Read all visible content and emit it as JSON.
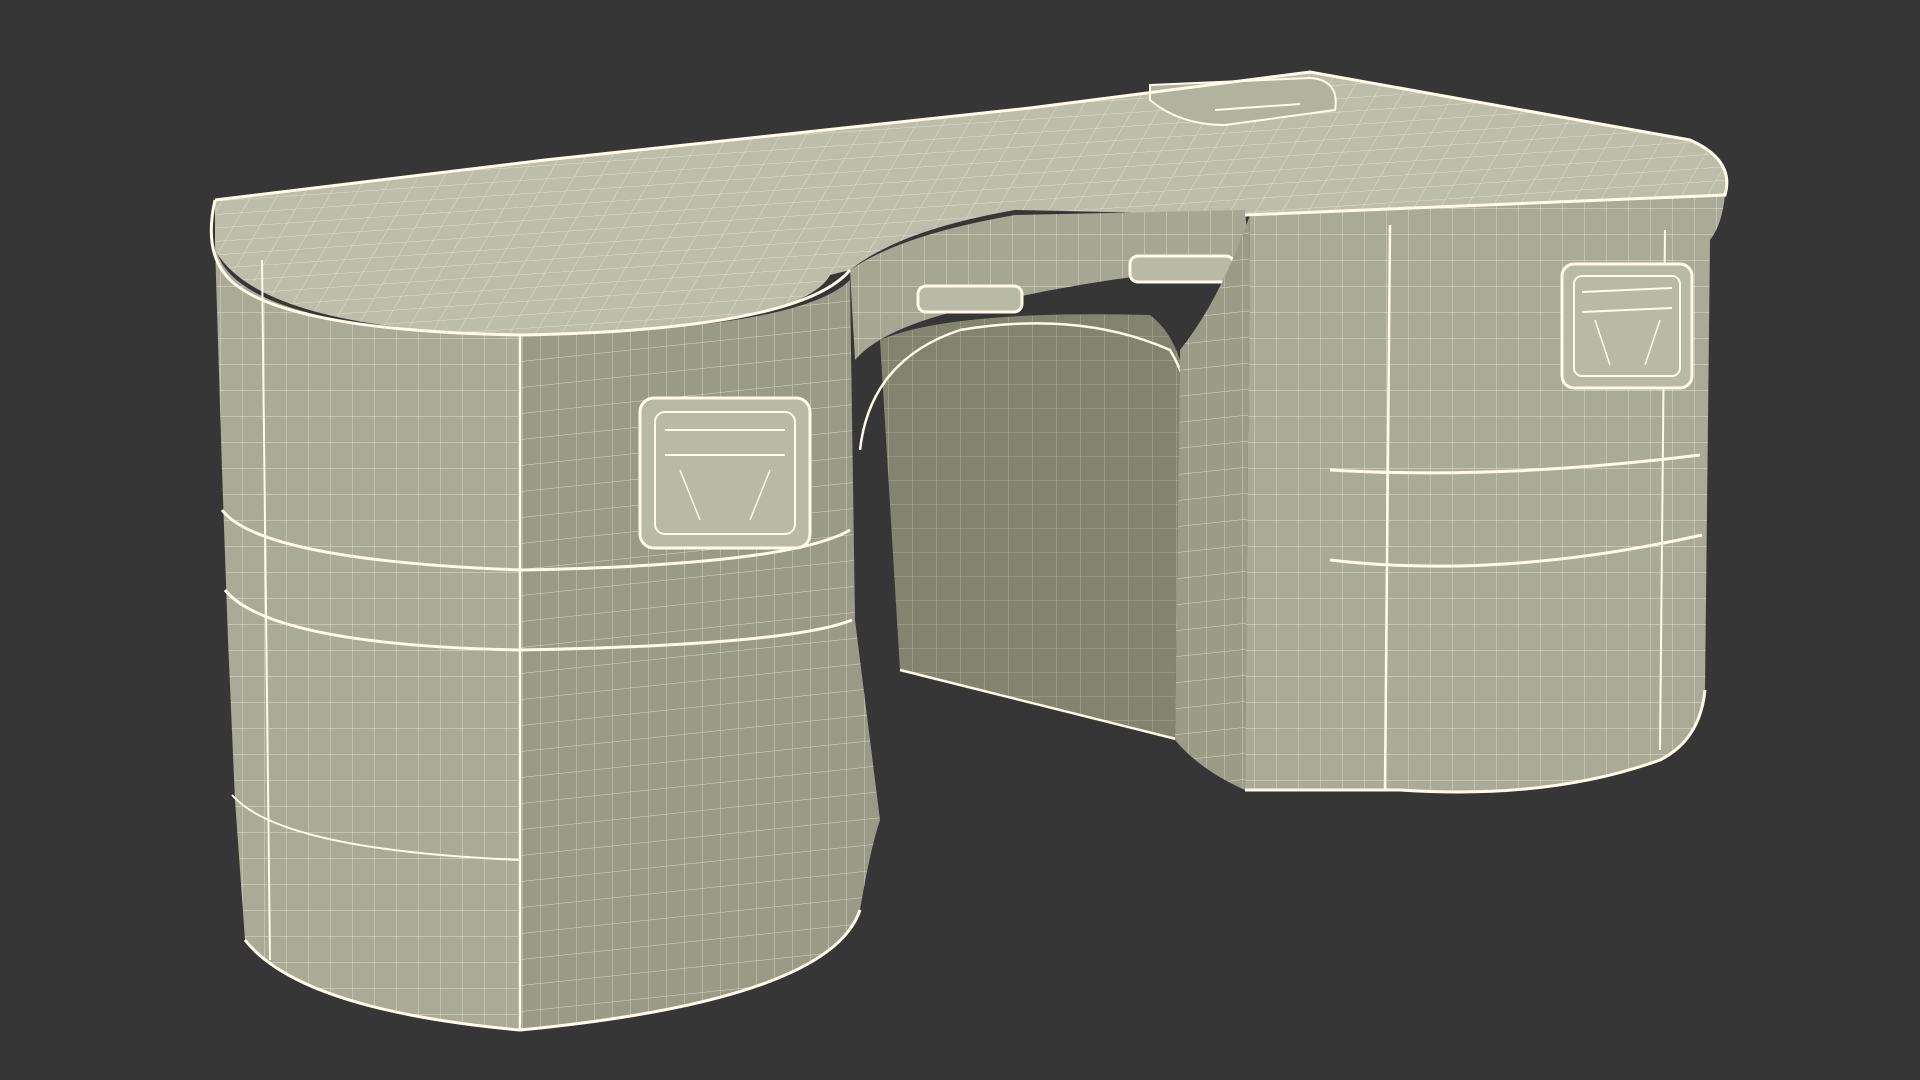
{
  "viewport": {
    "background_color": "#363636"
  },
  "model": {
    "subject": "desk",
    "render_style": "wireframe-over-shaded",
    "surface_color_front": "#a9ab97",
    "surface_color_side": "#999b87",
    "surface_color_top": "#bcbeaa",
    "surface_color_inner": "#82846f",
    "wire_color": "#f4f1dc",
    "edge_color": "#fffbe8",
    "parts": [
      "left-pedestal",
      "right-pedestal",
      "desktop",
      "knee-hole",
      "drawer-handles",
      "top-tray"
    ]
  }
}
